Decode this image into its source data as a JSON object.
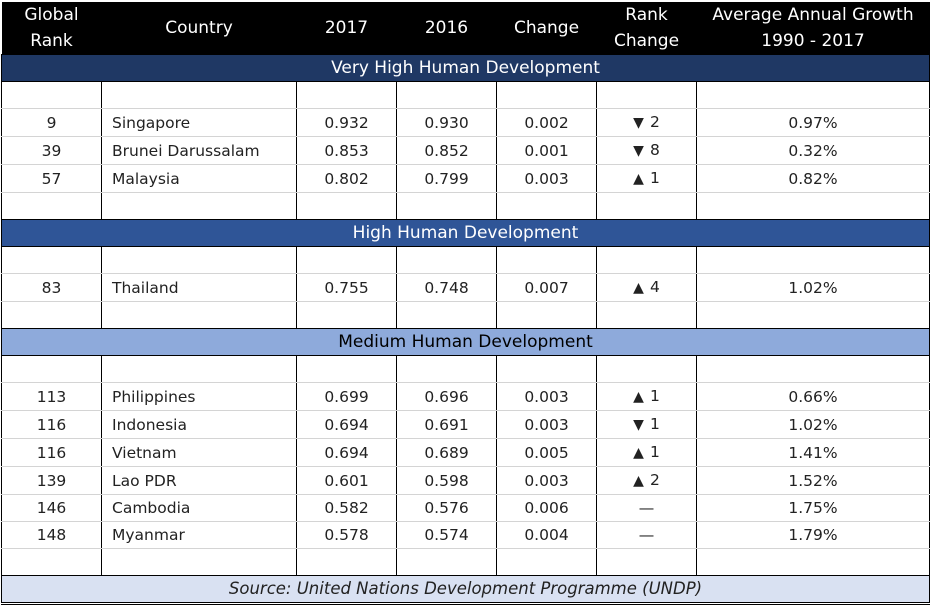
{
  "columns": [
    "Global Rank",
    "Country",
    "2017",
    "2016",
    "Change",
    "Rank Change",
    "Average Annual Growth 1990 - 2017"
  ],
  "header": {
    "rank_line1": "Global",
    "rank_line2": "Rank",
    "country": "Country",
    "y2017": "2017",
    "y2016": "2016",
    "change": "Change",
    "rank_change_line1": "Rank",
    "rank_change_line2": "Change",
    "growth_line1": "Average Annual Growth",
    "growth_line2": "1990 - 2017"
  },
  "groups": [
    {
      "title": "Very High Human Development",
      "color": "#1f3864",
      "rows": [
        {
          "rank": "9",
          "country": "Singapore",
          "y2017": "0.932",
          "y2016": "0.930",
          "change": "0.002",
          "rank_dir": "down",
          "rank_icon": "▼",
          "rank_change": "2",
          "growth": "0.97%"
        },
        {
          "rank": "39",
          "country": "Brunei Darussalam",
          "y2017": "0.853",
          "y2016": "0.852",
          "change": "0.001",
          "rank_dir": "down",
          "rank_icon": "▼",
          "rank_change": "8",
          "growth": "0.32%"
        },
        {
          "rank": "57",
          "country": "Malaysia",
          "y2017": "0.802",
          "y2016": "0.799",
          "change": "0.003",
          "rank_dir": "up",
          "rank_icon": "▲",
          "rank_change": "1",
          "growth": "0.82%"
        }
      ]
    },
    {
      "title": "High Human Development",
      "color": "#2f5597",
      "rows": [
        {
          "rank": "83",
          "country": "Thailand",
          "y2017": "0.755",
          "y2016": "0.748",
          "change": "0.007",
          "rank_dir": "up",
          "rank_icon": "▲",
          "rank_change": "4",
          "growth": "1.02%"
        }
      ]
    },
    {
      "title": "Medium Human Development",
      "color": "#8eaadb",
      "rows": [
        {
          "rank": "113",
          "country": "Philippines",
          "y2017": "0.699",
          "y2016": "0.696",
          "change": "0.003",
          "rank_dir": "up",
          "rank_icon": "▲",
          "rank_change": "1",
          "growth": "0.66%"
        },
        {
          "rank": "116",
          "country": "Indonesia",
          "y2017": "0.694",
          "y2016": "0.691",
          "change": "0.003",
          "rank_dir": "down",
          "rank_icon": "▼",
          "rank_change": "1",
          "growth": "1.02%"
        },
        {
          "rank": "116",
          "country": "Vietnam",
          "y2017": "0.694",
          "y2016": "0.689",
          "change": "0.005",
          "rank_dir": "up",
          "rank_icon": "▲",
          "rank_change": "1",
          "growth": "1.41%"
        },
        {
          "rank": "139",
          "country": "Lao PDR",
          "y2017": "0.601",
          "y2016": "0.598",
          "change": "0.003",
          "rank_dir": "up",
          "rank_icon": "▲",
          "rank_change": "2",
          "growth": "1.52%"
        },
        {
          "rank": "146",
          "country": "Cambodia",
          "y2017": "0.582",
          "y2016": "0.576",
          "change": "0.006",
          "rank_dir": "none",
          "rank_icon": "",
          "rank_change": "—",
          "growth": "1.75%"
        },
        {
          "rank": "148",
          "country": "Myanmar",
          "y2017": "0.578",
          "y2016": "0.574",
          "change": "0.004",
          "rank_dir": "none",
          "rank_icon": "",
          "rank_change": "—",
          "growth": "1.79%"
        }
      ]
    }
  ],
  "source": "Source: United Nations Development Programme (UNDP)",
  "colors": {
    "header_bg": "#000000",
    "very_high_band": "#1f3864",
    "high_band": "#2f5597",
    "medium_band": "#8eaadb",
    "source_band": "#d9e1f2"
  }
}
